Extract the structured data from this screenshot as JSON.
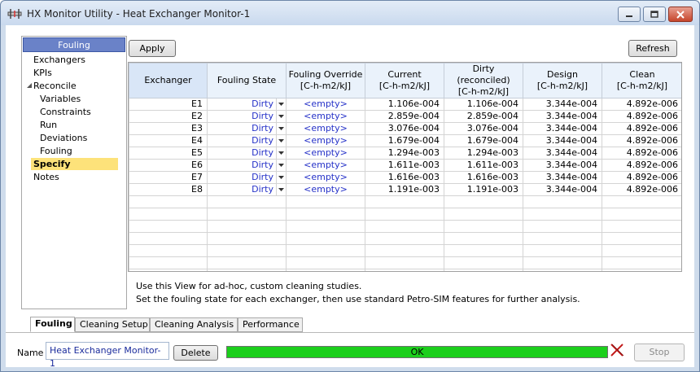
{
  "window": {
    "title": "HX Monitor Utility - Heat Exchanger Monitor-1",
    "app_icon": "hx-monitor-icon",
    "controls": [
      "minimize-icon",
      "maximize-icon",
      "close-icon"
    ]
  },
  "sidebar": {
    "header": "Fouling",
    "items": [
      {
        "label": "Exchangers"
      },
      {
        "label": "KPIs"
      },
      {
        "label": "Reconcile"
      },
      {
        "label": "Variables"
      },
      {
        "label": "Constraints"
      },
      {
        "label": "Run"
      },
      {
        "label": "Deviations"
      },
      {
        "label": "Fouling"
      },
      {
        "label": "Specify"
      },
      {
        "label": "Notes"
      }
    ]
  },
  "toolbar": {
    "apply_label": "Apply",
    "refresh_label": "Refresh"
  },
  "table": {
    "headers": [
      {
        "line1": "Exchanger",
        "line2": ""
      },
      {
        "line1": "Fouling State",
        "line2": ""
      },
      {
        "line1": "Fouling Override",
        "line2": "[C-h-m2/kJ]"
      },
      {
        "line1": "Current",
        "line2": "[C-h-m2/kJ]"
      },
      {
        "line1": "Dirty (reconciled)",
        "line2": "[C-h-m2/kJ]"
      },
      {
        "line1": "Design",
        "line2": "[C-h-m2/kJ]"
      },
      {
        "line1": "Clean",
        "line2": "[C-h-m2/kJ]"
      }
    ],
    "rows": [
      {
        "exchanger": "E1",
        "state": "Dirty",
        "override": "<empty>",
        "current": "1.106e-004",
        "dirty": "1.106e-004",
        "design": "3.344e-004",
        "clean": "4.892e-006"
      },
      {
        "exchanger": "E2",
        "state": "Dirty",
        "override": "<empty>",
        "current": "2.859e-004",
        "dirty": "2.859e-004",
        "design": "3.344e-004",
        "clean": "4.892e-006"
      },
      {
        "exchanger": "E3",
        "state": "Dirty",
        "override": "<empty>",
        "current": "3.076e-004",
        "dirty": "3.076e-004",
        "design": "3.344e-004",
        "clean": "4.892e-006"
      },
      {
        "exchanger": "E4",
        "state": "Dirty",
        "override": "<empty>",
        "current": "1.679e-004",
        "dirty": "1.679e-004",
        "design": "3.344e-004",
        "clean": "4.892e-006"
      },
      {
        "exchanger": "E5",
        "state": "Dirty",
        "override": "<empty>",
        "current": "1.294e-003",
        "dirty": "1.294e-003",
        "design": "3.344e-004",
        "clean": "4.892e-006"
      },
      {
        "exchanger": "E6",
        "state": "Dirty",
        "override": "<empty>",
        "current": "1.611e-003",
        "dirty": "1.611e-003",
        "design": "3.344e-004",
        "clean": "4.892e-006"
      },
      {
        "exchanger": "E7",
        "state": "Dirty",
        "override": "<empty>",
        "current": "1.616e-003",
        "dirty": "1.616e-003",
        "design": "3.344e-004",
        "clean": "4.892e-006"
      },
      {
        "exchanger": "E8",
        "state": "Dirty",
        "override": "<empty>",
        "current": "1.191e-003",
        "dirty": "1.191e-003",
        "design": "3.344e-004",
        "clean": "4.892e-006"
      }
    ]
  },
  "info": {
    "line1": "Use this View for ad-hoc, custom cleaning studies.",
    "line2": "Set the fouling state for each exchanger, then use standard Petro-SIM features for further analysis."
  },
  "tabs": [
    {
      "label": "Fouling"
    },
    {
      "label": "Cleaning Setup"
    },
    {
      "label": "Cleaning Analysis"
    },
    {
      "label": "Performance"
    }
  ],
  "footer": {
    "name_label": "Name",
    "name_value": "Heat Exchanger Monitor-1",
    "delete_label": "Delete",
    "status_text": "OK",
    "progress": 1.0,
    "stop_label": "Stop",
    "colors": {
      "progress": "#1ccf1c",
      "sidebar_header": "#6a82c8",
      "selected_item": "#fde27a",
      "link_text": "#2531c8"
    }
  }
}
